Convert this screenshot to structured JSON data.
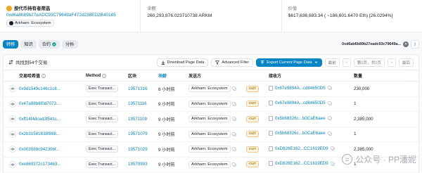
{
  "overview": {
    "filter_title": "按代币持有者筛选",
    "address": "0xd6a8b89b27eADC93C79649aF472d238ED2B40165",
    "address_tag": "Arkham: Ecosystem",
    "balance_label": "余额",
    "balance_value": "260,293,876.023710738 ARKM",
    "value_label": "价值",
    "value_value": "$617,636,683.34 ( ~186,601.6470 Eth) [26.0294%]"
  },
  "tabs": [
    {
      "label": "转移",
      "active": true
    },
    {
      "label": "知识",
      "active": false
    },
    {
      "label": "合约",
      "active": false
    },
    {
      "label": "分析",
      "active": false
    }
  ],
  "filter_chip": "0xd6ab6b89b27eadc93c79649a...",
  "toolbar": {
    "found_text": "共找到54个交易",
    "download_label": "Download Page Data",
    "advanced_filter_label": "Advanced Filter",
    "export_label": "Export Current Page Data"
  },
  "pagination": {
    "first": "最前",
    "prev": "‹",
    "info": "第1页，共1页",
    "next": "›",
    "last": "最后"
  },
  "columns": {
    "hash": "交易哈希值",
    "method": "Method",
    "block": "区块",
    "age": "块龄",
    "from": "发送方",
    "to": "接收方",
    "amount": "数量"
  },
  "rows": [
    {
      "hash": "0x9d1549c146c1c8...",
      "method": "Exec Transact...",
      "block": "19571316",
      "age": "8 小时前",
      "from": "Arkham: Ecosystem",
      "direction": "OUT",
      "to": "0x67e9894A...cd84650D5",
      "amount": "230,000"
    },
    {
      "hash": "0x47a88b6f0d7073...",
      "method": "Exec Transact...",
      "block": "19571116",
      "age": "9 小时前",
      "from": "Arkham: Ecosystem",
      "direction": "OUT",
      "to": "0x67e9894A...cd84650D5",
      "amount": "1"
    },
    {
      "hash": "0xff14f4dced3f541c...",
      "method": "Exec Transact...",
      "block": "19571109",
      "age": "9 小时前",
      "from": "Arkham: Ecosystem",
      "direction": "OUT",
      "to": "0x5b68326c...b0CaE6aee",
      "amount": "2,385,000"
    },
    {
      "hash": "0x2b31581838f868...",
      "method": "Exec Transact...",
      "block": "19571079",
      "age": "9 小时前",
      "from": "Arkham: Ecosystem",
      "direction": "OUT",
      "to": "0x5b68326c...b0CaE6aee",
      "amount": "1"
    },
    {
      "hash": "0x003588c94230bf...",
      "method": "Exec Transact...",
      "block": "19571029",
      "age": "9 小时前",
      "from": "Arkham: Ecosystem",
      "direction": "OUT",
      "to": "0xD828E162...CC1619ED9",
      "amount": "2,385,000"
    },
    {
      "hash": "0xe869372c173463...",
      "method": "Exec Transact...",
      "block": "19570993",
      "age": "9 小时前",
      "from": "Arkham: Ecosystem",
      "direction": "OUT",
      "to": "0xD828E162...CC1619ED9",
      "amount": "1"
    }
  ],
  "watermark": "公众号 · PP潘妮",
  "colors": {
    "link": "#0784c3",
    "active_tab": "#0784c3",
    "out_badge": "#fdf3e1",
    "token_icon": "#f5a623"
  }
}
